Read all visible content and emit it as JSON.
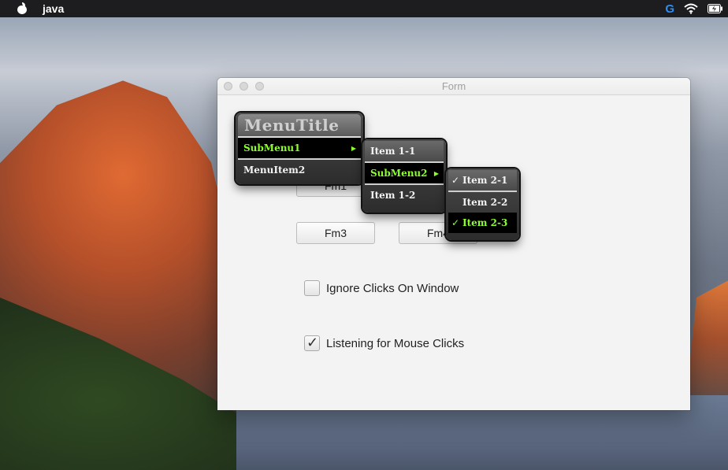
{
  "menubar": {
    "app_name": "java"
  },
  "window": {
    "title": "Form"
  },
  "buttons": {
    "fm1": "Fm1",
    "fm3": "Fm3",
    "fm4": "Fm4"
  },
  "checkboxes": [
    {
      "label": "Ignore Clicks On Window",
      "checked": false
    },
    {
      "label": "Listening for Mouse Clicks",
      "checked": true
    }
  ],
  "menu": {
    "title": "MenuTitle",
    "items": [
      "SubMenu1",
      "MenuItem2"
    ],
    "submenu1": {
      "items": [
        "Item 1-1",
        "SubMenu2",
        "Item 1-2"
      ],
      "submenu2": {
        "items": [
          {
            "label": "Item 2-1",
            "checked": true
          },
          {
            "label": "Item 2-2",
            "checked": false
          },
          {
            "label": "Item 2-3",
            "checked": true
          }
        ]
      }
    }
  },
  "colors": {
    "menu_highlight_text": "#8cff2a",
    "menu_bg": "#2c2c2c",
    "menubar_bg": "#1d1d1f",
    "google_icon": "#2b8ef5"
  }
}
